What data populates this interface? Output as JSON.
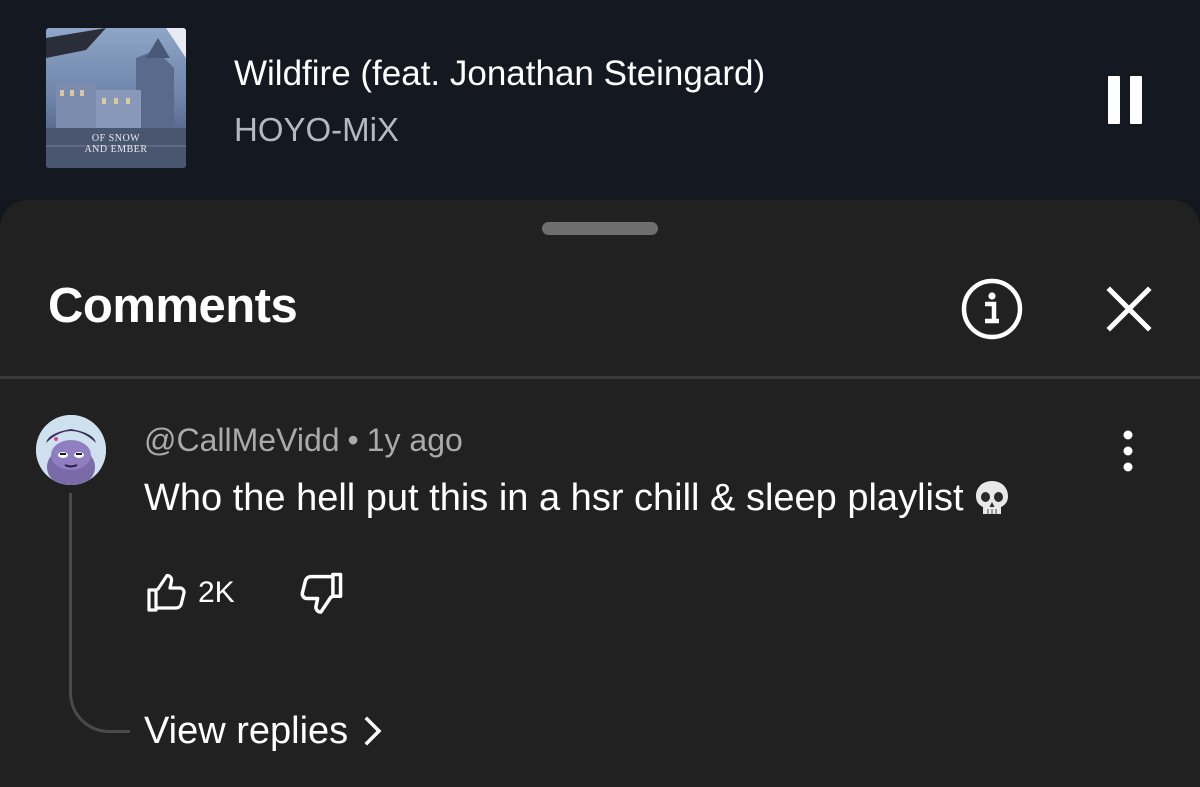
{
  "player": {
    "album_caption_line1": "OF SNOW",
    "album_caption_line2": "AND EMBER",
    "track_title": "Wildfire (feat. Jonathan Steingard)",
    "artist": "HOYO-MiX",
    "state": "playing",
    "pause_icon": "pause-icon"
  },
  "comments_panel": {
    "title": "Comments",
    "info_icon": "info-icon",
    "close_icon": "close-icon"
  },
  "comment": {
    "author": "@CallMeVidd",
    "separator": "•",
    "time": "1y ago",
    "text": "Who the hell put this in a hsr chill & sleep playlist",
    "emoji": "skull-emoji",
    "like_count": "2K",
    "view_replies_label": "View replies"
  },
  "colors": {
    "player_bg": "#141821",
    "sheet_bg": "#212121",
    "secondary_text": "#aaaaaa",
    "artist_text": "#b4b8c0"
  }
}
